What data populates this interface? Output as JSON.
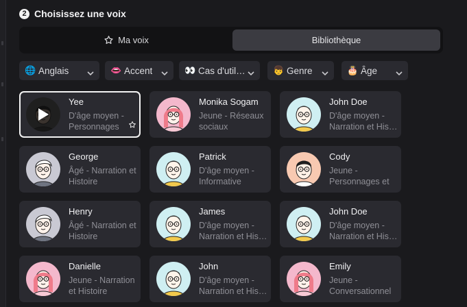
{
  "header": {
    "step": "2",
    "title": "Choisissez une voix"
  },
  "tabs": [
    {
      "label": "Ma voix",
      "icon": "star-outline-icon",
      "active": false
    },
    {
      "label": "Bibliothèque",
      "active": true
    }
  ],
  "filters": [
    {
      "label": "Anglais",
      "icon": "globe-icon",
      "glyph": "🌐"
    },
    {
      "label": "Accent",
      "icon": "lips-icon",
      "glyph": "👄"
    },
    {
      "label": "Cas d'util…",
      "icon": "eyes-icon",
      "glyph": "👀"
    },
    {
      "label": "Genre",
      "icon": "person-icon",
      "glyph": "👦"
    },
    {
      "label": "Âge",
      "icon": "birthday-cake-icon",
      "glyph": "🎂"
    }
  ],
  "voices": [
    {
      "name": "Yee",
      "desc": "D'âge moyen - Personnages et…",
      "avatar": "dark",
      "selected": true
    },
    {
      "name": "Monika Sogam",
      "desc": "Jeune - Réseaux sociaux",
      "avatar": "pink"
    },
    {
      "name": "John Doe",
      "desc": "D'âge moyen - Narration et His…",
      "avatar": "mint"
    },
    {
      "name": "George",
      "desc": "Âgé - Narration et Histoire",
      "avatar": "grey"
    },
    {
      "name": "Patrick",
      "desc": "D'âge moyen - Informative",
      "avatar": "mint"
    },
    {
      "name": "Cody",
      "desc": "Jeune - Personnages et …",
      "avatar": "peach"
    },
    {
      "name": "Henry",
      "desc": "Âgé - Narration et Histoire",
      "avatar": "grey"
    },
    {
      "name": "James",
      "desc": "D'âge moyen - Narration et His…",
      "avatar": "mint"
    },
    {
      "name": "John Doe",
      "desc": "D'âge moyen - Narration et His…",
      "avatar": "mint"
    },
    {
      "name": "Danielle",
      "desc": "Jeune - Narration et Histoire",
      "avatar": "pink"
    },
    {
      "name": " John",
      "desc": "D'âge moyen - Narration et His…",
      "avatar": "mint"
    },
    {
      "name": "Emily",
      "desc": "Jeune - Conversationnel",
      "avatar": "pink"
    }
  ],
  "colors": {
    "background": "#1a1a1d",
    "card": "#2a2a30",
    "tab_active": "#3b3b41",
    "text_muted": "#8f8f96"
  }
}
